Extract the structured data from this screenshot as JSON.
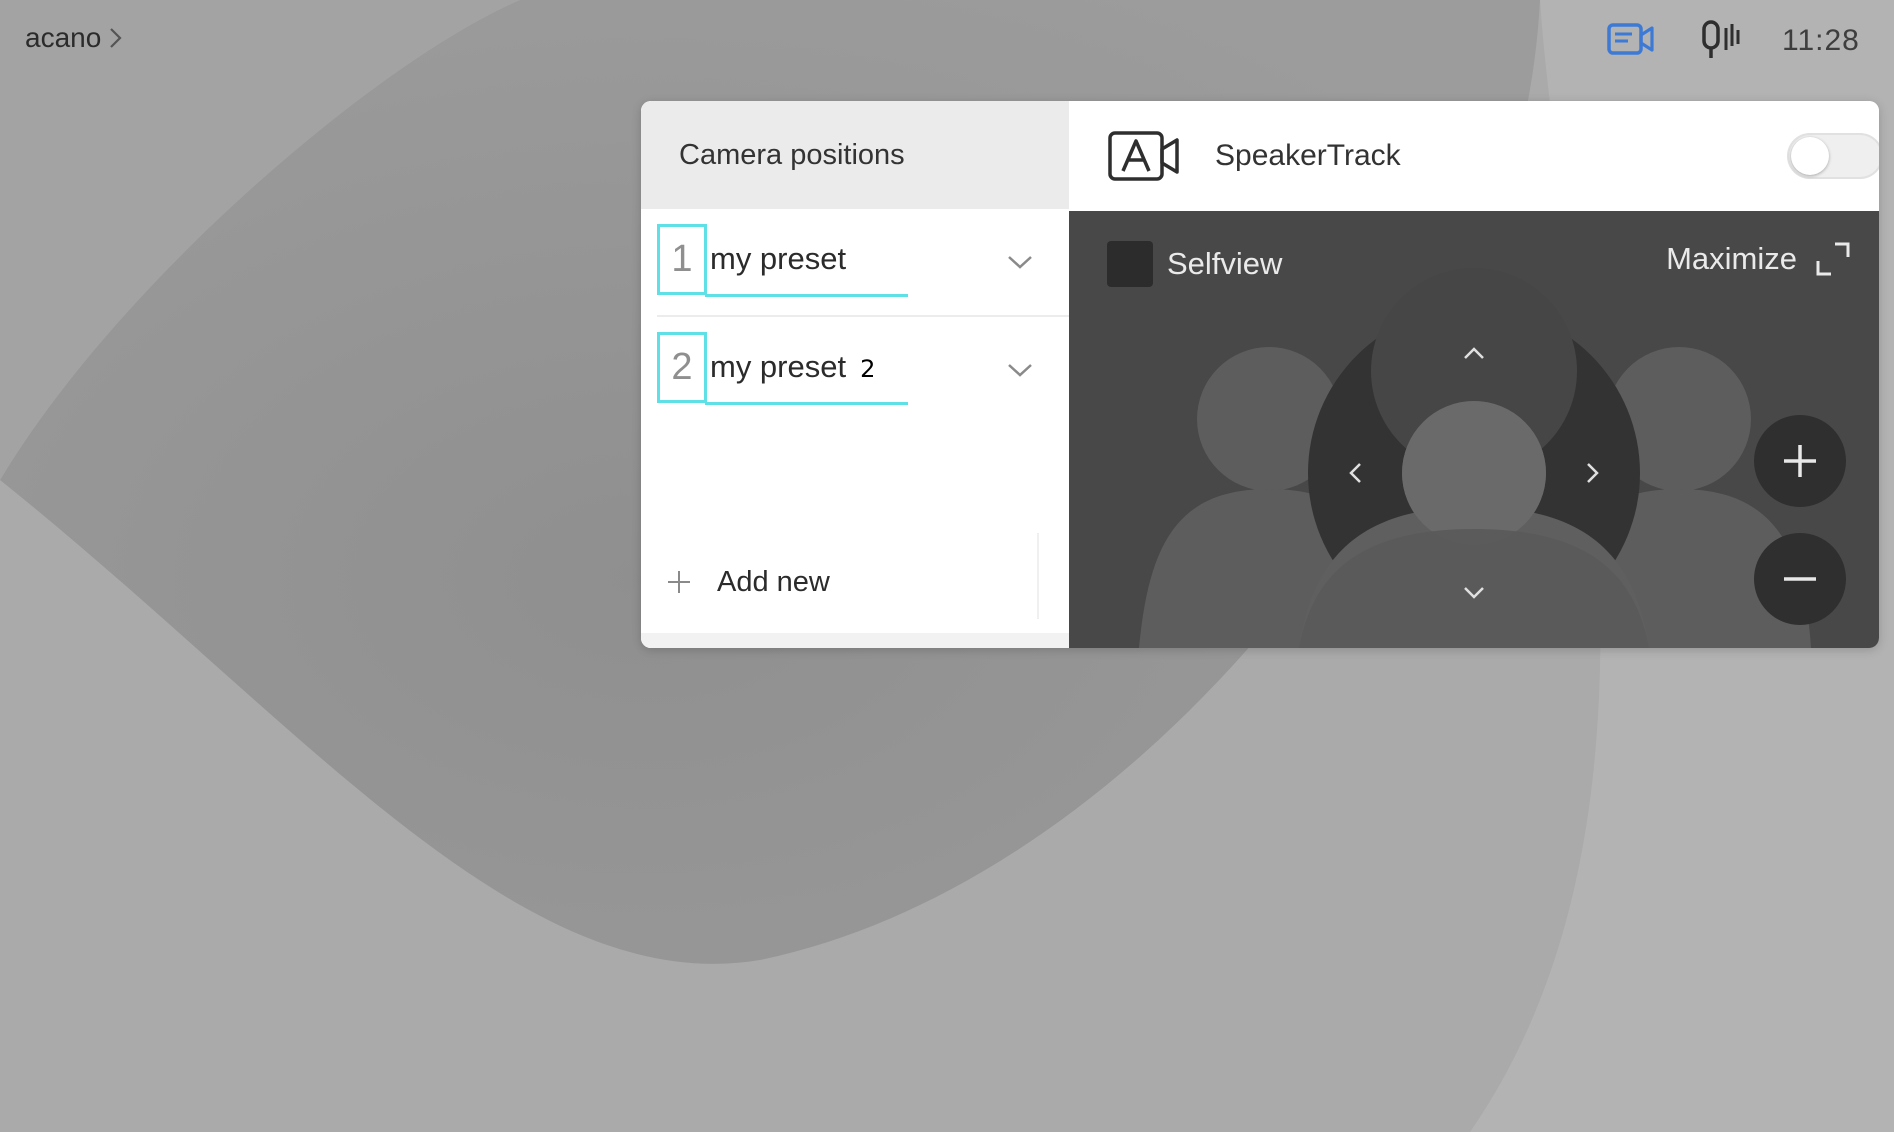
{
  "topbar": {
    "room_name": "acano",
    "status_icons": [
      "camera-panel-icon",
      "microphone-icon"
    ],
    "clock": "11:28"
  },
  "camera_panel": {
    "title": "Camera positions",
    "presets": [
      {
        "number": "1",
        "label": "my preset",
        "suffix": ""
      },
      {
        "number": "2",
        "label": "my preset",
        "suffix": "2"
      }
    ],
    "add_new_label": "Add new",
    "highlight_color": "#5fe0e6"
  },
  "speakertrack": {
    "label": "SpeakerTrack",
    "icon": "speakertrack-icon",
    "enabled": false
  },
  "selfview": {
    "label": "Selfview",
    "maximize_label": "Maximize",
    "controls": [
      "pan-up",
      "pan-down",
      "pan-left",
      "pan-right",
      "zoom-in",
      "zoom-out"
    ]
  }
}
